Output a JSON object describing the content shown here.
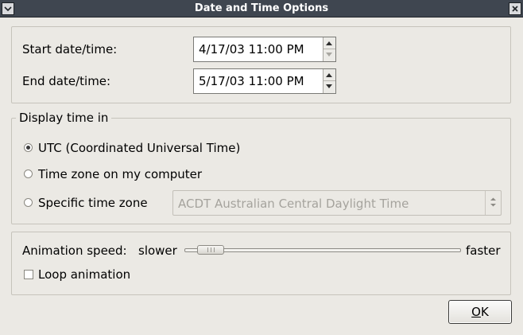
{
  "window": {
    "title": "Date and Time Options"
  },
  "range": {
    "start_label": "Start date/time:",
    "start_value": "4/17/03 11:00 PM",
    "end_label": "End date/time:",
    "end_value": "5/17/03 11:00 PM"
  },
  "display_time": {
    "heading": "Display time in",
    "options": [
      {
        "label": "UTC (Coordinated Universal Time)",
        "selected": true
      },
      {
        "label": "Time zone on my computer",
        "selected": false
      },
      {
        "label": "Specific time zone",
        "selected": false
      }
    ],
    "timezone_select": {
      "value": "ACDT Australian Central Daylight Time",
      "enabled": false
    }
  },
  "animation": {
    "speed_label": "Animation speed:",
    "slower_label": "slower",
    "faster_label": "faster",
    "speed_fraction": 0.05,
    "loop_label": "Loop animation",
    "loop_checked": false
  },
  "actions": {
    "ok_label": "OK"
  }
}
